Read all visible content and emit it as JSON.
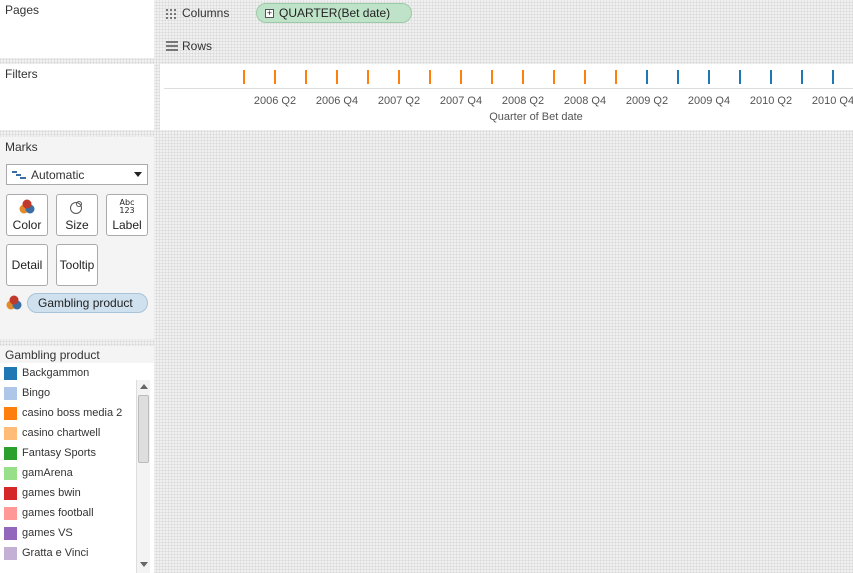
{
  "left": {
    "pages_title": "Pages",
    "filters_title": "Filters",
    "marks_title": "Marks",
    "mark_type": "Automatic",
    "buttons": {
      "color": "Color",
      "size": "Size",
      "label": "Label",
      "label_icon": "Abc\n123",
      "detail": "Detail",
      "tooltip": "Tooltip"
    },
    "color_pill": "Gambling product"
  },
  "shelves": {
    "columns_label": "Columns",
    "columns_pill": "QUARTER(Bet date)",
    "rows_label": "Rows"
  },
  "legend": {
    "title": "Gambling product",
    "items": [
      {
        "label": "Backgammon",
        "color": "#1f77b4"
      },
      {
        "label": "Bingo",
        "color": "#aec7e8"
      },
      {
        "label": "casino boss media 2",
        "color": "#ff7f0e"
      },
      {
        "label": "casino chartwell",
        "color": "#ffbb78"
      },
      {
        "label": "Fantasy Sports",
        "color": "#2ca02c"
      },
      {
        "label": "gamArena",
        "color": "#98df8a"
      },
      {
        "label": "games bwin",
        "color": "#d62728"
      },
      {
        "label": "games football",
        "color": "#ff9896"
      },
      {
        "label": "games VS",
        "color": "#9467bd"
      },
      {
        "label": "Gratta e Vinci",
        "color": "#c5b0d5"
      }
    ]
  },
  "chart_data": {
    "type": "scatter",
    "xlabel": "Quarter of Bet date",
    "x": [
      "2006 Q1",
      "2006 Q2",
      "2006 Q3",
      "2006 Q4",
      "2007 Q1",
      "2007 Q2",
      "2007 Q3",
      "2007 Q4",
      "2008 Q1",
      "2008 Q2",
      "2008 Q3",
      "2008 Q4",
      "2009 Q1",
      "2009 Q2",
      "2009 Q3",
      "2009 Q4",
      "2010 Q1",
      "2010 Q2",
      "2010 Q3",
      "2010 Q4"
    ],
    "tick_labels": [
      "2006 Q2",
      "2006 Q4",
      "2007 Q2",
      "2007 Q4",
      "2008 Q2",
      "2008 Q4",
      "2009 Q2",
      "2009 Q4",
      "2010 Q2",
      "2010 Q4"
    ],
    "series": [
      {
        "name": "casino boss media 2",
        "color": "#ff7f0e",
        "x": [
          "2006 Q1",
          "2006 Q2",
          "2006 Q3",
          "2006 Q4",
          "2007 Q1",
          "2007 Q2",
          "2007 Q3",
          "2007 Q4",
          "2008 Q1",
          "2008 Q2",
          "2008 Q3",
          "2008 Q4",
          "2009 Q1"
        ]
      },
      {
        "name": "Backgammon",
        "color": "#1f77b4",
        "x": [
          "2009 Q2",
          "2009 Q3",
          "2009 Q4",
          "2010 Q1",
          "2010 Q2",
          "2010 Q3",
          "2010 Q4"
        ]
      }
    ]
  }
}
